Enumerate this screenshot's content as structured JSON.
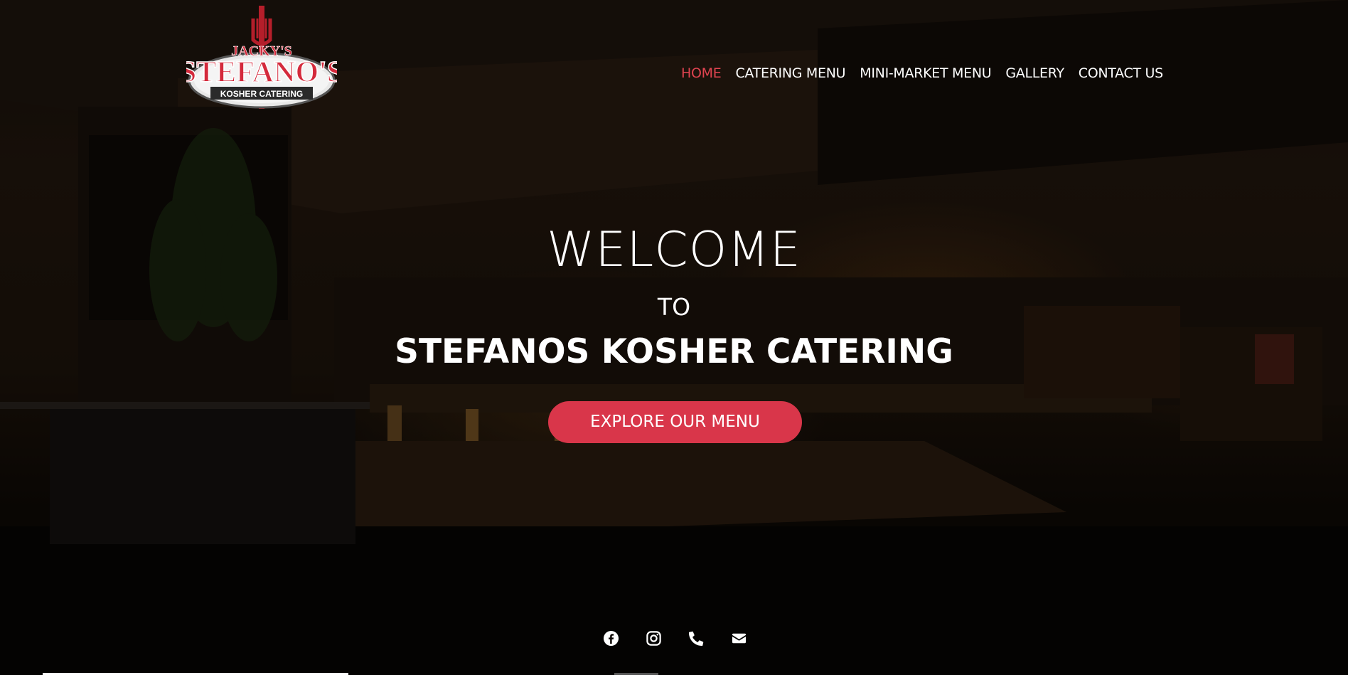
{
  "brand": {
    "logo_top": "JACKY'S",
    "logo_main": "STEFANO'S",
    "logo_sub": "KOSHER CATERING"
  },
  "nav": {
    "items": [
      {
        "label": "HOME",
        "active": true
      },
      {
        "label": "CATERING MENU",
        "active": false
      },
      {
        "label": "MINI-MARKET MENU",
        "active": false
      },
      {
        "label": "GALLERY",
        "active": false
      },
      {
        "label": "CONTACT US",
        "active": false
      }
    ]
  },
  "hero": {
    "welcome": "WELCOME",
    "to": "TO",
    "title": "STEFANOS KOSHER CATERING",
    "cta_label": "EXPLORE OUR MENU"
  },
  "social": {
    "icons": [
      "facebook-icon",
      "instagram-icon",
      "phone-icon",
      "envelope-icon"
    ]
  },
  "colors": {
    "accent": "#d9364a",
    "nav_active": "#e04450",
    "text": "#ffffff"
  }
}
